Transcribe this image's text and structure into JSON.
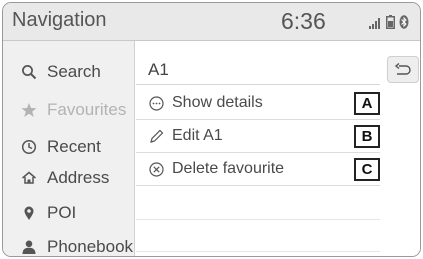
{
  "header": {
    "title": "Navigation",
    "clock": "6:36",
    "status_icons": [
      "signal-icon",
      "battery-icon",
      "bluetooth-icon"
    ]
  },
  "sidebar": {
    "items": [
      {
        "label": "Search",
        "icon": "search-icon",
        "active": false
      },
      {
        "label": "Favourites",
        "icon": "star-icon",
        "active": true
      },
      {
        "label": "Recent",
        "icon": "clock-icon",
        "active": false
      },
      {
        "label": "Address",
        "icon": "home-icon",
        "active": false
      },
      {
        "label": "POI",
        "icon": "pin-icon",
        "active": false
      },
      {
        "label": "Phonebook",
        "icon": "person-icon",
        "active": false
      }
    ]
  },
  "main": {
    "title": "A1",
    "back_icon": "back-arrow-icon",
    "options": [
      {
        "label": "Show details",
        "icon": "ellipsis-circle-icon",
        "callout": "A"
      },
      {
        "label": "Edit A1",
        "icon": "pencil-icon",
        "callout": "B"
      },
      {
        "label": "Delete favourite",
        "icon": "x-circle-icon",
        "callout": "C"
      }
    ]
  },
  "colors": {
    "header_bg": "#e9e9e9",
    "sidebar_bg": "#f0f0f0",
    "active_item": "#b3b3b3",
    "text": "#4a4a4a"
  }
}
